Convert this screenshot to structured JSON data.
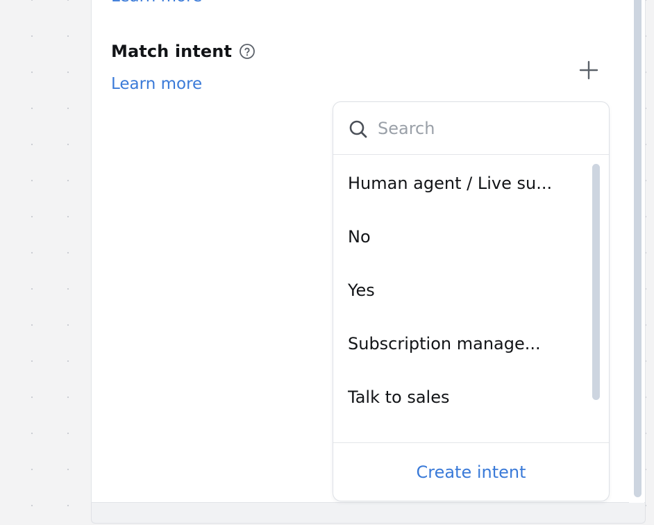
{
  "panel": {
    "learn_more_top": "Learn more",
    "section": {
      "title": "Match intent",
      "learn_more": "Learn more",
      "help_icon": "question-circle-icon",
      "add_icon": "plus-icon"
    }
  },
  "dropdown": {
    "search": {
      "placeholder": "Search",
      "value": "",
      "icon": "search-icon"
    },
    "items": [
      {
        "label": "Human agent / Live su..."
      },
      {
        "label": "No"
      },
      {
        "label": "Yes"
      },
      {
        "label": "Subscription manage..."
      },
      {
        "label": "Talk to sales"
      }
    ],
    "create_label": "Create intent"
  },
  "colors": {
    "link": "#3a7ad8",
    "text": "#121417",
    "placeholder": "#9aa0a8",
    "scrollbar": "#cdd5e0",
    "border": "#dde0e5",
    "canvas": "#f3f3f4"
  }
}
